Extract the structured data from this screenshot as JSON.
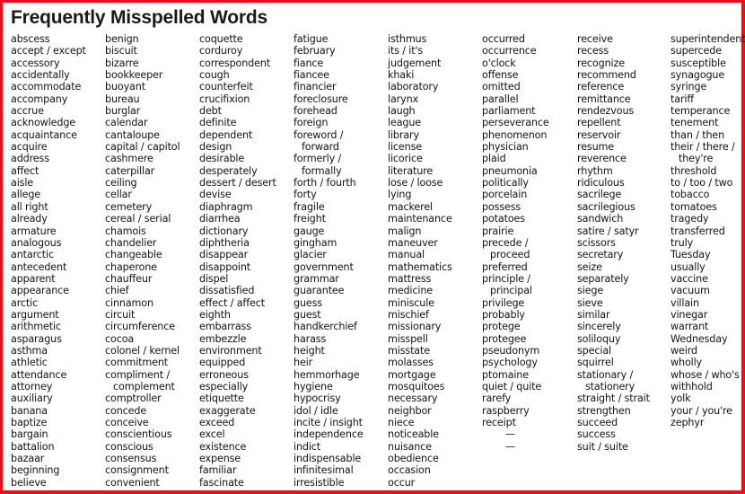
{
  "title": "Frequently Misspelled Words",
  "columns": [
    [
      "abscess",
      "accept / except",
      "accessory",
      "accidentally",
      "accommodate",
      "accompany",
      "accrue",
      "acknowledge",
      "acquaintance",
      "acquire",
      "address",
      "affect",
      "aisle",
      "allege",
      "all right",
      "already",
      "armature",
      "analogous",
      "antarctic",
      "antecedent",
      "apparent",
      "appearance",
      "arctic",
      "argument",
      "arithmetic",
      "asparagus",
      "asthma",
      "athletic",
      "attendance",
      "attorney",
      "auxiliary",
      "banana",
      "baptize",
      "bargain",
      "battalion",
      "bazaar",
      "beginning",
      "believe"
    ],
    [
      "benign",
      "biscuit",
      "bizarre",
      "bookkeeper",
      "buoyant",
      "bureau",
      "burglar",
      "calendar",
      "cantaloupe",
      "capital / capitol",
      "cashmere",
      "caterpillar",
      "ceiling",
      "cellar",
      "cemetery",
      "cereal / serial",
      "chamois",
      "chandelier",
      "changeable",
      "chaperone",
      "chauffeur",
      "chief",
      "cinnamon",
      "circuit",
      "circumference",
      "cocoa",
      "colonel / kernel",
      "commitment",
      "compliment /",
      "+complement",
      "comptroller",
      "concede",
      "conceive",
      "conscientious",
      "conscious",
      "consensus",
      "consignment",
      "convenient"
    ],
    [
      "coquette",
      "corduroy",
      "correspondent",
      "cough",
      "counterfeit",
      "crucifixion",
      "debt",
      "definite",
      "dependent",
      "design",
      "desirable",
      "desperately",
      "dessert / desert",
      "devise",
      "diaphragm",
      "diarrhea",
      "dictionary",
      "diphtheria",
      "disappear",
      "disappoint",
      "dispel",
      "dissatisfied",
      "effect / affect",
      "eighth",
      "embarrass",
      "embezzle",
      "environment",
      "equipped",
      "erroneous",
      "especially",
      "etiquette",
      "exaggerate",
      "exceed",
      "excel",
      "existence",
      "expense",
      "familiar",
      "fascinate"
    ],
    [
      "fatigue",
      "february",
      "fiance",
      "fiancee",
      "financier",
      "foreclosure",
      "forehead",
      "foreign",
      "foreword /",
      "+forward",
      "formerly /",
      "+formally",
      "forth / fourth",
      "forty",
      "fragile",
      "freight",
      "gauge",
      "gingham",
      "glacier",
      "government",
      "grammar",
      "guarantee",
      "guess",
      "guest",
      "handkerchief",
      "harass",
      "height",
      "heir",
      "hemmorhage",
      "hygiene",
      "hypocrisy",
      "idol / idle",
      "incite / insight",
      "independence",
      "indict",
      "indispensable",
      "infinitesimal",
      "irresistible"
    ],
    [
      "isthmus",
      "its / it's",
      "judgement",
      "khaki",
      "laboratory",
      "larynx",
      "laugh",
      "league",
      "library",
      "license",
      "licorice",
      "literature",
      "lose / loose",
      "lying",
      "mackerel",
      "maintenance",
      "malign",
      "maneuver",
      "manual",
      "mathematics",
      "mattress",
      "medicine",
      "miniscule",
      "mischief",
      "missionary",
      "misspell",
      "misstate",
      "molasses",
      "mortgage",
      "mosquitoes",
      "necessary",
      "neighbor",
      "niece",
      "noticeable",
      "nuisance",
      "obedience",
      "occasion",
      "occur"
    ],
    [
      "occurred",
      "occurrence",
      "o'clock",
      "offense",
      "omitted",
      "parallel",
      "parliament",
      "perseverance",
      "phenomenon",
      "physician",
      "plaid",
      "pneumonia",
      "politically",
      "porcelain",
      "possess",
      "potatoes",
      "prairie",
      "precede /",
      "+proceed",
      "preferred",
      "principle /",
      "+principal",
      "privilege",
      "probably",
      "protege",
      "protegee",
      "pseudonym",
      "psychology",
      "ptomaine",
      "quiet / quite",
      "rarefy",
      "raspberry",
      "receipt",
      "—",
      "—"
    ],
    [
      "receive",
      "recess",
      "recognize",
      "recommend",
      "reference",
      "remittance",
      "rendezvous",
      "repellent",
      "reservoir",
      "resume",
      "reverence",
      "rhythm",
      "ridiculous",
      "sacrilege",
      "sacrilegious",
      "sandwich",
      "satire / satyr",
      "scissors",
      "secretary",
      "seize",
      "separately",
      "siege",
      "sieve",
      "similar",
      "sincerely",
      "soliloquy",
      "special",
      "squirrel",
      "stationary /",
      "+stationery",
      "straight / strait",
      "strengthen",
      "succeed",
      "success",
      "suit / suite"
    ],
    [
      "superintendent",
      "supercede",
      "susceptible",
      "synagogue",
      "syringe",
      "tariff",
      "temperance",
      "tenement",
      "than / then",
      "their / there /",
      "+they're",
      "threshold",
      "to / too / two",
      "tobacco",
      "tomatoes",
      "tragedy",
      "transferred",
      "truly",
      "Tuesday",
      "usually",
      "vaccine",
      "vacuum",
      "villain",
      "vinegar",
      "warrant",
      "Wednesday",
      "weird",
      "wholly",
      "whose / who's",
      "withhold",
      "yolk",
      "your / you're",
      "zephyr"
    ]
  ]
}
